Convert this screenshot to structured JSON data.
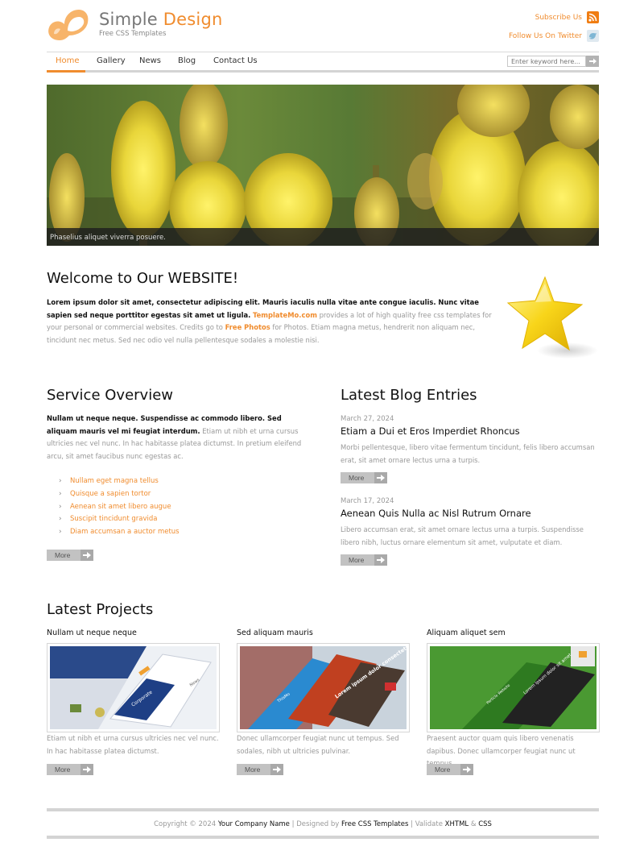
{
  "header": {
    "title_main": "Simple",
    "title_accent": "Design",
    "tagline": "Free CSS Templates",
    "subscribe": "Subscribe Us",
    "follow": "Follow Us On Twitter",
    "icons": {
      "logo": "logo-icon",
      "subscribe": "rss-icon",
      "follow": "twitter-bird-icon"
    }
  },
  "nav": {
    "items": [
      "Home",
      "Gallery",
      "News",
      "Blog",
      "Contact Us"
    ],
    "active": "Home",
    "search_placeholder": "Enter keyword here..."
  },
  "banner": {
    "caption": "Phaselius aliquet viverra posuere."
  },
  "welcome": {
    "title": "Welcome to Our WEBSITE!",
    "bold_text": "Lorem ipsum dolor sit amet, consectetur adipiscing elit. Mauris iaculis nulla vitae ante congue iaculis. Nunc vitae sapien sed neque porttitor egestas sit amet ut ligula.",
    "link1": "TemplateMo.com",
    "text_mid": " provides a lot of high quality free css templates for your personal or commercial websites. Credits go to ",
    "link2": "Free Photos",
    "text_end": " for Photos. Etiam magna metus, hendrerit non aliquam nec, tincidunt nec metus. Sed nec odio vel nulla pellentesque sodales a molestie nisi."
  },
  "service": {
    "title": "Service Overview",
    "bold_text": "Nullam ut neque neque. Suspendisse ac commodo libero. Sed aliquam mauris vel mi feugiat interdum.",
    "text": " Etiam ut nibh et urna cursus ultricies nec vel nunc. In hac habitasse platea dictumst. In pretium eleifend arcu, sit amet faucibus nunc egestas ac.",
    "list": [
      "Nullam eget magna tellus",
      "Quisque a sapien tortor",
      "Aenean sit amet libero augue",
      "Suscipit tincidunt gravida",
      "Diam accumsan a auctor metus"
    ],
    "more": "More"
  },
  "blog": {
    "title": "Latest Blog Entries",
    "entries": [
      {
        "date": "March 27, 2024",
        "title": "Etiam a Dui et Eros Imperdiet Rhoncus",
        "text": "Morbi pellentesque, libero vitae fermentum tincidunt, felis libero accumsan erat, sit amet ornare lectus urna a turpis.",
        "more": "More"
      },
      {
        "date": "March 17, 2024",
        "title": "Aenean Quis Nulla ac Nisl Rutrum Ornare",
        "text": "Libero accumsan erat, sit amet ornare lectus urna a turpis. Suspendisse libero nibh, luctus ornare elementum sit amet, vulputate et diam.",
        "more": "More"
      }
    ]
  },
  "projects": {
    "title": "Latest Projects",
    "items": [
      {
        "title": "Nullam ut neque neque",
        "text": "Etiam ut nibh et urna cursus ultricies nec vel nunc. In hac habitasse platea dictumst.",
        "more": "More",
        "img_label_1": "Corporate",
        "img_label_2": "News"
      },
      {
        "title": "Sed aliquam mauris",
        "text": "Donec ullamcorper feugiat nunc ut tempus. Sed sodales, nibh ut ultricies pulvinar.",
        "more": "More",
        "img_label_1": "Lorem ipsum dolor consectetur adipiscing",
        "img_label_2": "ThisMo"
      },
      {
        "title": "Aliquam aliquet sem",
        "text": "Praesent auctor quam quis libero venenatis dapibus. Donec ullamcorper feugiat nunc ut tempus.",
        "more": "More",
        "img_label_1": "Lorem ipsum dolor sit amet",
        "img_label_2": "Particle Website"
      }
    ]
  },
  "footer": {
    "copyright": "Copyright © 2024",
    "company": "Your Company Name",
    "designed_by": "Designed by",
    "designer": "Free CSS Templates",
    "validate": "Validate",
    "xhtml": "XHTML",
    "amp": "&",
    "css": "CSS"
  },
  "colors": {
    "accent": "#f08c2e",
    "heading": "#111111",
    "body": "#999999",
    "button": "#c2c2c2"
  }
}
